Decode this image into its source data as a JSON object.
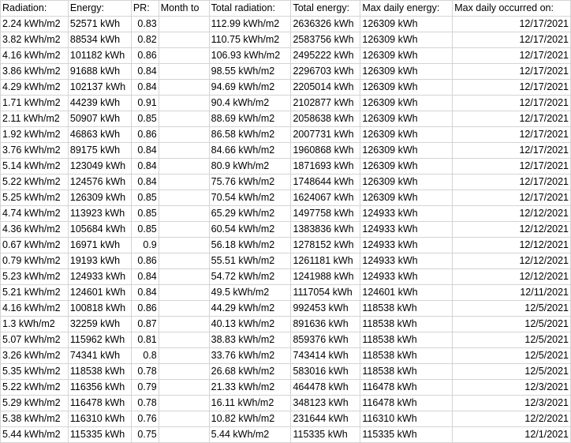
{
  "headers": [
    "Radiation:",
    "Energy:",
    "PR:",
    "Month to",
    "Total radiation:",
    "Total energy:",
    "Max daily energy:",
    "Max daily occurred on:"
  ],
  "rows": [
    [
      "2.24 kWh/m2",
      "52571 kWh",
      "0.83",
      "",
      "112.99 kWh/m2",
      "2636326 kWh",
      "126309 kWh",
      "12/17/2021"
    ],
    [
      "3.82 kWh/m2",
      "88534 kWh",
      "0.82",
      "",
      "110.75 kWh/m2",
      "2583756 kWh",
      "126309 kWh",
      "12/17/2021"
    ],
    [
      "4.16 kWh/m2",
      "101182 kWh",
      "0.86",
      "",
      "106.93 kWh/m2",
      "2495222 kWh",
      "126309 kWh",
      "12/17/2021"
    ],
    [
      "3.86 kWh/m2",
      "91688 kWh",
      "0.84",
      "",
      "98.55 kWh/m2",
      "2296703 kWh",
      "126309 kWh",
      "12/17/2021"
    ],
    [
      "4.29 kWh/m2",
      "102137 kWh",
      "0.84",
      "",
      "94.69 kWh/m2",
      "2205014 kWh",
      "126309 kWh",
      "12/17/2021"
    ],
    [
      "1.71 kWh/m2",
      "44239 kWh",
      "0.91",
      "",
      "90.4 kWh/m2",
      "2102877 kWh",
      "126309 kWh",
      "12/17/2021"
    ],
    [
      "2.11 kWh/m2",
      "50907 kWh",
      "0.85",
      "",
      "88.69 kWh/m2",
      "2058638 kWh",
      "126309 kWh",
      "12/17/2021"
    ],
    [
      "1.92 kWh/m2",
      "46863 kWh",
      "0.86",
      "",
      "86.58 kWh/m2",
      "2007731 kWh",
      "126309 kWh",
      "12/17/2021"
    ],
    [
      "3.76 kWh/m2",
      "89175 kWh",
      "0.84",
      "",
      "84.66 kWh/m2",
      "1960868 kWh",
      "126309 kWh",
      "12/17/2021"
    ],
    [
      "5.14 kWh/m2",
      "123049 kWh",
      "0.84",
      "",
      "80.9 kWh/m2",
      "1871693 kWh",
      "126309 kWh",
      "12/17/2021"
    ],
    [
      "5.22 kWh/m2",
      "124576 kWh",
      "0.84",
      "",
      "75.76 kWh/m2",
      "1748644 kWh",
      "126309 kWh",
      "12/17/2021"
    ],
    [
      "5.25 kWh/m2",
      "126309 kWh",
      "0.85",
      "",
      "70.54 kWh/m2",
      "1624067 kWh",
      "126309 kWh",
      "12/17/2021"
    ],
    [
      "4.74 kWh/m2",
      "113923 kWh",
      "0.85",
      "",
      "65.29 kWh/m2",
      "1497758 kWh",
      "124933 kWh",
      "12/12/2021"
    ],
    [
      "4.36 kWh/m2",
      "105684 kWh",
      "0.85",
      "",
      "60.54 kWh/m2",
      "1383836 kWh",
      "124933 kWh",
      "12/12/2021"
    ],
    [
      "0.67 kWh/m2",
      "16971 kWh",
      "0.9",
      "",
      "56.18 kWh/m2",
      "1278152 kWh",
      "124933 kWh",
      "12/12/2021"
    ],
    [
      "0.79 kWh/m2",
      "19193 kWh",
      "0.86",
      "",
      "55.51 kWh/m2",
      "1261181 kWh",
      "124933 kWh",
      "12/12/2021"
    ],
    [
      "5.23 kWh/m2",
      "124933 kWh",
      "0.84",
      "",
      "54.72 kWh/m2",
      "1241988 kWh",
      "124933 kWh",
      "12/12/2021"
    ],
    [
      "5.21 kWh/m2",
      "124601 kWh",
      "0.84",
      "",
      "49.5 kWh/m2",
      "1117054 kWh",
      "124601 kWh",
      "12/11/2021"
    ],
    [
      "4.16 kWh/m2",
      "100818 kWh",
      "0.86",
      "",
      "44.29 kWh/m2",
      "992453 kWh",
      "118538 kWh",
      "12/5/2021"
    ],
    [
      "1.3 kWh/m2",
      "32259 kWh",
      "0.87",
      "",
      "40.13 kWh/m2",
      "891636 kWh",
      "118538 kWh",
      "12/5/2021"
    ],
    [
      "5.07 kWh/m2",
      "115962 kWh",
      "0.81",
      "",
      "38.83 kWh/m2",
      "859376 kWh",
      "118538 kWh",
      "12/5/2021"
    ],
    [
      "3.26 kWh/m2",
      "74341 kWh",
      "0.8",
      "",
      "33.76 kWh/m2",
      "743414 kWh",
      "118538 kWh",
      "12/5/2021"
    ],
    [
      "5.35 kWh/m2",
      "118538 kWh",
      "0.78",
      "",
      "26.68 kWh/m2",
      "583016 kWh",
      "118538 kWh",
      "12/5/2021"
    ],
    [
      "5.22 kWh/m2",
      "116356 kWh",
      "0.79",
      "",
      "21.33 kWh/m2",
      "464478 kWh",
      "116478 kWh",
      "12/3/2021"
    ],
    [
      "5.29 kWh/m2",
      "116478 kWh",
      "0.78",
      "",
      "16.11 kWh/m2",
      "348123 kWh",
      "116478 kWh",
      "12/3/2021"
    ],
    [
      "5.38 kWh/m2",
      "116310 kWh",
      "0.76",
      "",
      "10.82 kWh/m2",
      "231644 kWh",
      "116310 kWh",
      "12/2/2021"
    ],
    [
      "5.44 kWh/m2",
      "115335 kWh",
      "0.75",
      "",
      "5.44 kWh/m2",
      "115335 kWh",
      "115335 kWh",
      "12/1/2021"
    ]
  ]
}
